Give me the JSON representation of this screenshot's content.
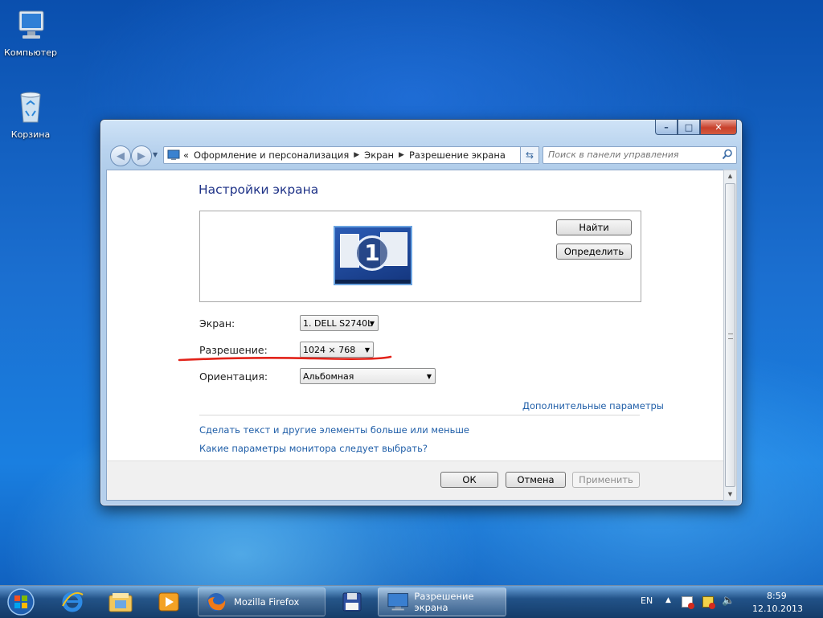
{
  "desktop": {
    "icons": [
      {
        "label": "Компьютер",
        "icon": "computer-icon"
      },
      {
        "label": "Корзина",
        "icon": "recycle-bin-icon"
      }
    ]
  },
  "window": {
    "address": {
      "overflow": "«",
      "segments": [
        "Оформление и персонализация",
        "Экран",
        "Разрешение экрана"
      ]
    },
    "search_placeholder": "Поиск в панели управления",
    "heading": "Настройки экрана",
    "monitor_number": "1",
    "buttons": {
      "detect": "Найти",
      "identify": "Определить"
    },
    "fields": {
      "display": {
        "label": "Экран:",
        "value": "1. DELL S2740L"
      },
      "resolution": {
        "label": "Разрешение:",
        "value": "1024 × 768"
      },
      "orientation": {
        "label": "Ориентация:",
        "value": "Альбомная"
      }
    },
    "links": {
      "advanced": "Дополнительные параметры",
      "text_size": "Сделать текст и другие элементы больше или меньше",
      "which_settings": "Какие параметры монитора следует выбрать?"
    },
    "footer": {
      "ok": "ОК",
      "cancel": "Отмена",
      "apply": "Применить"
    },
    "annotation_color": "#e2231a"
  },
  "taskbar": {
    "tasks": [
      {
        "label": "Mozilla Firefox",
        "icon": "firefox-icon"
      },
      {
        "label": "Разрешение экрана",
        "icon": "display-settings-icon"
      }
    ],
    "pinned": [
      "ie-icon",
      "explorer-icon",
      "media-player-icon",
      "floppy-icon"
    ],
    "language": "EN",
    "clock": {
      "time": "8:59",
      "date": "12.10.2013"
    }
  }
}
